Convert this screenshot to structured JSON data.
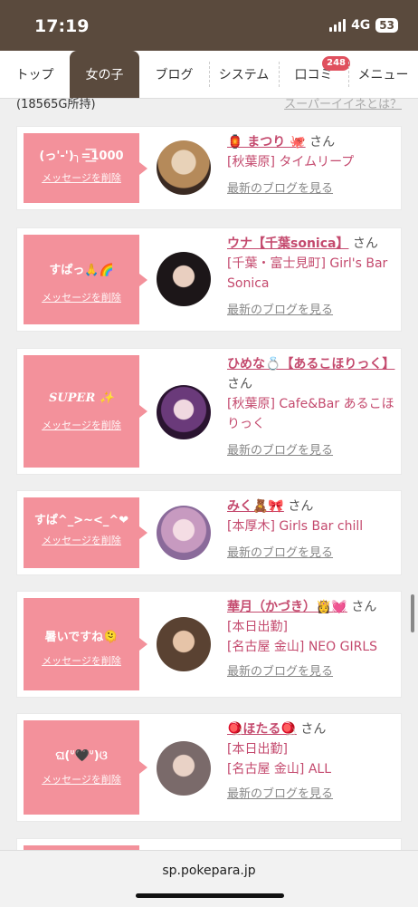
{
  "status": {
    "time": "17:19",
    "network": "4G",
    "battery": "53"
  },
  "nav": {
    "tabs": [
      {
        "label": "トップ"
      },
      {
        "label": "女の子"
      },
      {
        "label": "ブログ"
      },
      {
        "label": "システム"
      },
      {
        "label": "口コミ",
        "badge": "248"
      },
      {
        "label": "メニュー"
      }
    ]
  },
  "top": {
    "points": "(18565G所持)",
    "super_link": "スーパーイイネとは？"
  },
  "cards": [
    {
      "message": "(っ'-')╮=͟͟͞͞1000",
      "delete": "メッセージを削除",
      "name": "🏮 まつり 🐙",
      "san": "さん",
      "shop": "[秋葉原] タイムリープ",
      "blog": "最新のブログを見る"
    },
    {
      "message": "すぱっ🙏🌈",
      "delete": "メッセージを削除",
      "name": "ウナ【千葉sonica】",
      "san": "さん",
      "shop": "[千葉・富士見町] Girl's Bar Sonica",
      "blog": "最新のブログを見る"
    },
    {
      "message": "SUPER ✨",
      "delete": "メッセージを削除",
      "name": "ひめな💍【あるこほりっく】",
      "san": "さん",
      "shop": "[秋葉原] Cafe&Bar あるこほりっく",
      "blog": "最新のブログを見る"
    },
    {
      "message": "すぱ^_>~<_^❤",
      "delete": "メッセージを削除",
      "name": "みく🧸🎀",
      "san": "さん",
      "shop": "[本厚木] Girls Bar chill",
      "blog": "最新のブログを見る"
    },
    {
      "message": "暑いですね🫠",
      "delete": "メッセージを削除",
      "name": "華月（かづき）👸💓",
      "san": "さん",
      "shop_prefix": "[本日出勤]",
      "shop": "[名古屋 金山] NEO GIRLS",
      "blog": "最新のブログを見る"
    },
    {
      "message": "ଘ(ᐡ🖤ᐡ)ଓ",
      "delete": "メッセージを削除",
      "name": "🪀ほたる🪀",
      "san": "さん",
      "shop_prefix": "[本日出勤]",
      "shop": "[名古屋 金山] ALL",
      "blog": "最新のブログを見る"
    }
  ],
  "url": "sp.pokepara.jp"
}
